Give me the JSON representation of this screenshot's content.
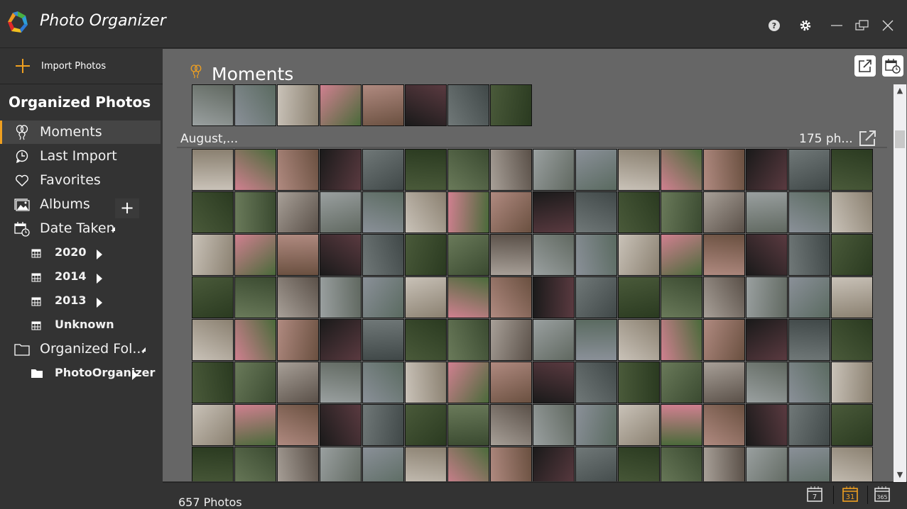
{
  "app": {
    "title": "Photo Organizer"
  },
  "window_controls": {
    "help": "help-icon",
    "settings": "gear-icon",
    "minimize": "minimize-icon",
    "restore": "restore-icon",
    "close": "close-icon"
  },
  "sidebar": {
    "import_label": "Import Photos",
    "section_title": "Organized Photos",
    "items": [
      {
        "label": "Moments",
        "icon": "balloons-icon",
        "active": true
      },
      {
        "label": "Last Import",
        "icon": "clock-icon"
      },
      {
        "label": "Favorites",
        "icon": "heart-icon"
      },
      {
        "label": "Albums",
        "icon": "image-icon"
      },
      {
        "label": "Date Taken",
        "icon": "calendar-clock-icon"
      }
    ],
    "date_children": [
      {
        "label": "2020",
        "expandable": true
      },
      {
        "label": "2014",
        "expandable": true
      },
      {
        "label": "2013",
        "expandable": true
      },
      {
        "label": "Unknown",
        "expandable": false
      }
    ],
    "folders_label": "Organized Fol...",
    "folder_children": [
      {
        "label": "PhotoOrganizer"
      }
    ]
  },
  "main": {
    "title": "Moments",
    "month_label": "August,...",
    "month_count": "175 ph...",
    "accent": "#f0a020"
  },
  "status": {
    "count_text": "657 Photos",
    "views": [
      {
        "label": "7",
        "active": false
      },
      {
        "label": "31",
        "active": true
      },
      {
        "label": "365",
        "active": false
      }
    ]
  }
}
